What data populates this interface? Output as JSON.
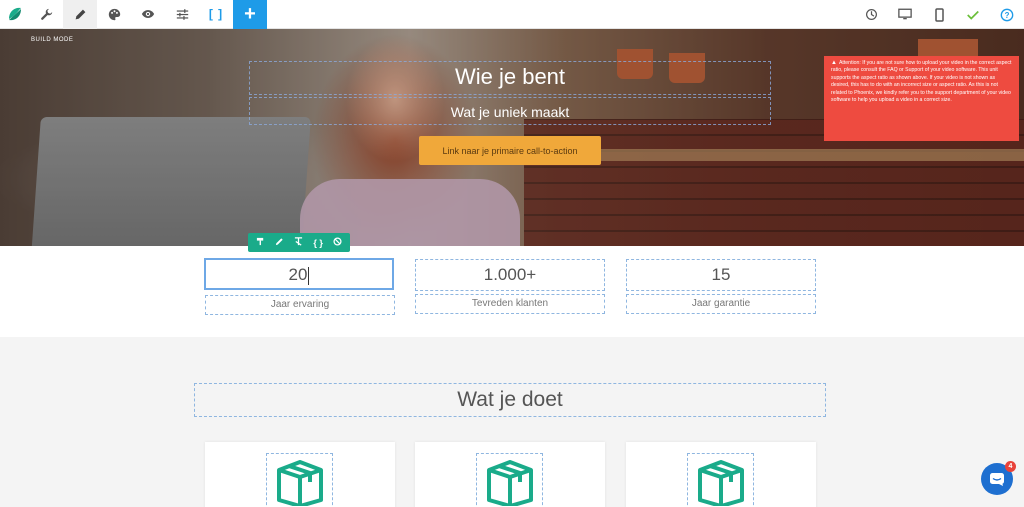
{
  "toolbar": {
    "left_icons": [
      "settings-wrench-icon",
      "pencil-icon",
      "palette-icon",
      "eye-icon",
      "sliders-icon"
    ],
    "brackets_label": "[ ]",
    "plus_label": "+",
    "right_icons": [
      "history-icon",
      "desktop-icon",
      "mobile-icon",
      "check-icon",
      "help-icon"
    ]
  },
  "colors": {
    "accent_blue": "#1e9be8",
    "cta": "#f0a83a",
    "edit_bar": "#1aab8a",
    "warning": "#ee4b40",
    "box_icon": "#1aab8a"
  },
  "hero": {
    "build_mode": "BUILD MODE",
    "title": "Wie je bent",
    "subtitle": "Wat je uniek maakt",
    "cta_label": "Link naar je primaire call-to-action"
  },
  "warning": {
    "text": "Attention: If you are not sure how to upload your video in the correct aspect ratio, please consult the FAQ or Support of your video software. This unit supports the aspect ratio as shown above. If your video is not shown as desired, this has to do with an incorrect size or aspect ratio. As this is not related to Phoenix, we kindly refer you to the support department of your video software to help you upload a video in a correct size."
  },
  "edit_bar": {
    "icons": [
      "paint-roller-icon",
      "pencil-icon",
      "clear-format-icon",
      "code-braces-icon",
      "block-icon"
    ],
    "code_label": "{ }"
  },
  "stats": [
    {
      "value": "20",
      "label": "Jaar ervaring"
    },
    {
      "value": "1.000+",
      "label": "Tevreden klanten"
    },
    {
      "value": "15",
      "label": "Jaar garantie"
    }
  ],
  "services": {
    "title": "Wat je doet",
    "cards": [
      {
        "icon": "box-icon"
      },
      {
        "icon": "box-icon"
      },
      {
        "icon": "box-icon"
      }
    ]
  },
  "chat": {
    "badge": "4"
  }
}
